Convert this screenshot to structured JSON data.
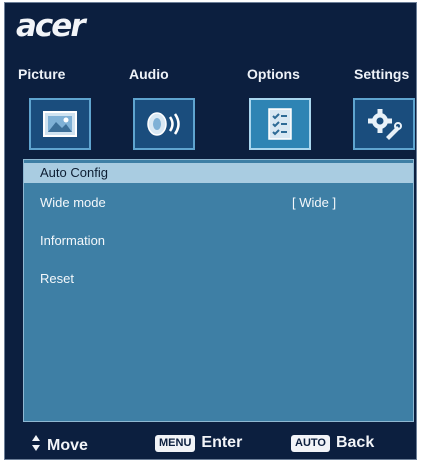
{
  "brand": {
    "logo_text": "acer"
  },
  "tabs": [
    {
      "label": "Picture",
      "icon": "picture-icon",
      "active": false
    },
    {
      "label": "Audio",
      "icon": "audio-icon",
      "active": false
    },
    {
      "label": "Options",
      "icon": "options-icon",
      "active": true
    },
    {
      "label": "Settings",
      "icon": "settings-icon",
      "active": false
    }
  ],
  "menu": {
    "items": [
      {
        "label": "Auto Config",
        "value": "",
        "selected": true
      },
      {
        "label": "Wide mode",
        "value": "[ Wide ]",
        "selected": false
      },
      {
        "label": "Information",
        "value": "",
        "selected": false
      },
      {
        "label": "Reset",
        "value": "",
        "selected": false
      }
    ]
  },
  "footer": {
    "move_label": "Move",
    "menu_key": "MENU",
    "enter_label": "Enter",
    "auto_key": "AUTO",
    "back_label": "Back"
  },
  "colors": {
    "frame": "#0c1f3f",
    "panel": "#3e7fa5",
    "selected": "#a9cce1",
    "tab_icon_active": "#2e84b4",
    "tab_icon": "#1a4d7d"
  }
}
